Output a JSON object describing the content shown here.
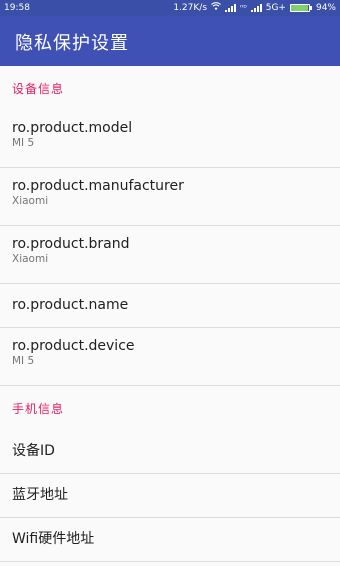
{
  "status_bar": {
    "time": "19:58",
    "net_speed": "1.27K/s",
    "network_type": "5G+",
    "battery_percent": "94%",
    "battery_level": 0.94,
    "battery_color": "#7fd16a"
  },
  "app_bar": {
    "title": "隐私保护设置",
    "color": "#3f51b5"
  },
  "sections": [
    {
      "header": "设备信息",
      "items": [
        {
          "title": "ro.product.model",
          "summary": "MI 5"
        },
        {
          "title": "ro.product.manufacturer",
          "summary": "Xiaomi"
        },
        {
          "title": "ro.product.brand",
          "summary": "Xiaomi"
        },
        {
          "title": "ro.product.name",
          "summary": ""
        },
        {
          "title": "ro.product.device",
          "summary": "MI 5"
        }
      ]
    },
    {
      "header": "手机信息",
      "items": [
        {
          "title": "设备ID"
        },
        {
          "title": "蓝牙地址"
        },
        {
          "title": "Wifi硬件地址"
        }
      ]
    }
  ],
  "colors": {
    "section_header": "#e91e63"
  }
}
